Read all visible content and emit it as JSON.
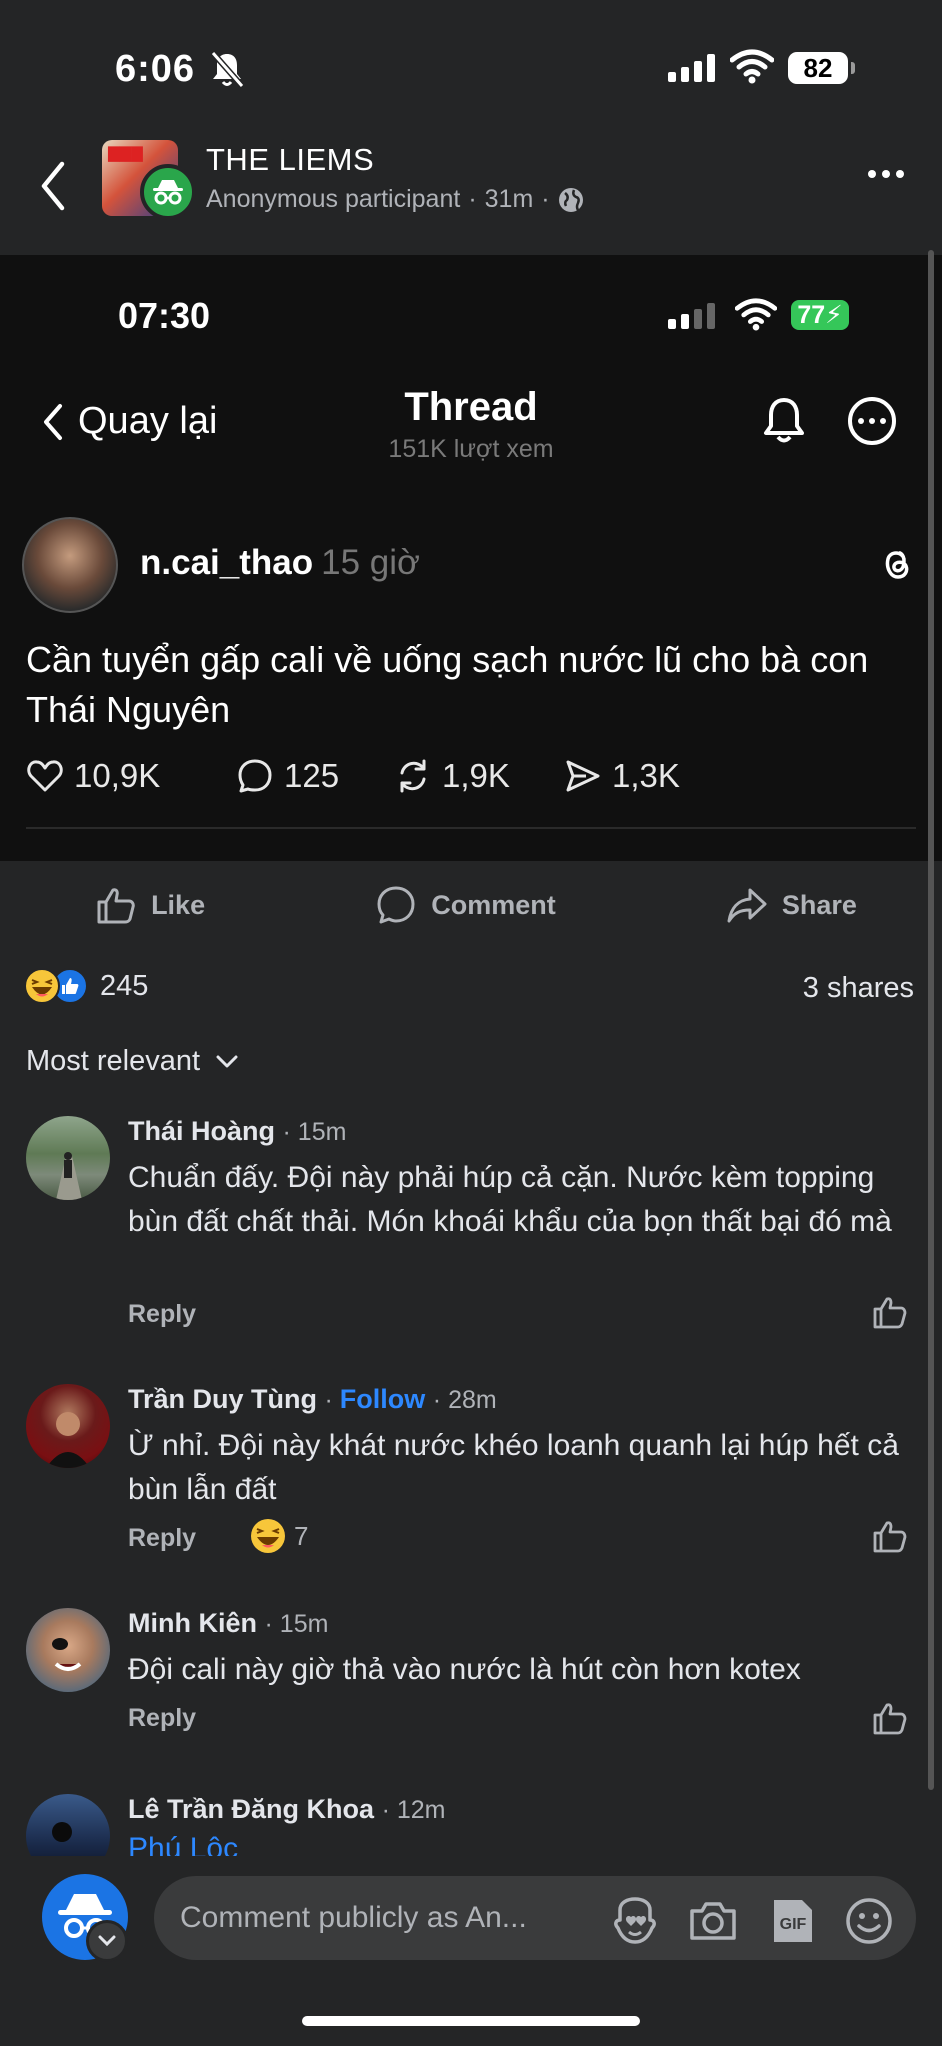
{
  "status_bar": {
    "time": "6:06",
    "battery": "82",
    "icons": [
      "bell-off-icon",
      "signal-icon",
      "wifi-icon",
      "battery-icon"
    ]
  },
  "post_header": {
    "group_name": "THE LIEMS",
    "author": "Anonymous participant",
    "time": "31m",
    "visibility_icon": "globe-icon"
  },
  "embedded": {
    "time": "07:30",
    "battery": "77",
    "back_label": "Quay lại",
    "title": "Thread",
    "views": "151K lượt xem",
    "username": "n.cai_thao",
    "posted_ago": "15 giờ",
    "post_text": "Cần tuyển gấp cali về uống sạch nước lũ cho bà con Thái Nguyên",
    "stats": {
      "likes": "10,9K",
      "replies": "125",
      "reposts": "1,9K",
      "shares": "1,3K"
    }
  },
  "actions": {
    "like": "Like",
    "comment": "Comment",
    "share": "Share"
  },
  "reactions": {
    "count": "245",
    "shares": "3 shares"
  },
  "sort_label": "Most relevant",
  "comments": [
    {
      "name": "Thái Hoàng",
      "time": "15m",
      "text": "Chuẩn đấy. Đội này phải húp cả cặn. Nước kèm topping bùn đất chất thải. Món khoái khẩu của bọn thất bại đó mà",
      "reply": "Reply"
    },
    {
      "name": "Trần Duy Tùng",
      "follow": "Follow",
      "time": "28m",
      "text": "Ừ nhỉ. Đội này khát nước khéo loanh quanh lại húp hết cả bùn lẫn đất",
      "reply": "Reply",
      "reaction_count": "7"
    },
    {
      "name": "Minh Kiên",
      "time": "15m",
      "text": "Đội cali này giờ thả vào nước là hút còn hơn kotex",
      "reply": "Reply"
    },
    {
      "name": "Lê Trần Đăng Khoa",
      "time": "12m",
      "location": "Phú Lộc"
    }
  ],
  "composer": {
    "placeholder": "Comment publicly as An..."
  },
  "colors": {
    "background": "#242526",
    "accent": "#2d88ff",
    "anon_badge": "#2aa64b"
  }
}
